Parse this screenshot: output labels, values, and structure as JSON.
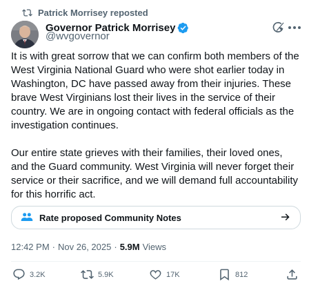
{
  "repost": {
    "label": "Patrick Morrisey reposted"
  },
  "author": {
    "name": "Governor Patrick Morrisey",
    "handle": "@wvgovernor"
  },
  "tweet": {
    "text": "It is with great sorrow that we can confirm both members of the West Virginia National Guard who were shot earlier today in Washington, DC have passed away from their injuries. These brave West Virginians lost their lives in the service of their country. We are in ongoing contact with federal officials as the investigation continues.\n\nOur entire state grieves with their families, their loved ones, and the Guard community. West Virginia will never forget their service or their sacrifice, and we will demand full accountability for this horrific act."
  },
  "community_notes": {
    "label": "Rate proposed Community Notes"
  },
  "meta": {
    "time": "12:42 PM",
    "separator1": "·",
    "date": "Nov 26, 2025",
    "separator2": "·",
    "views_count": "5.9M",
    "views_label": "Views"
  },
  "actions": {
    "replies": "3.2K",
    "reposts": "5.9K",
    "likes": "17K",
    "bookmarks": "812"
  },
  "colors": {
    "verified": "#1d9bf0",
    "secondary_text": "#536471",
    "community_notes_icon": "#1d9bf0"
  }
}
